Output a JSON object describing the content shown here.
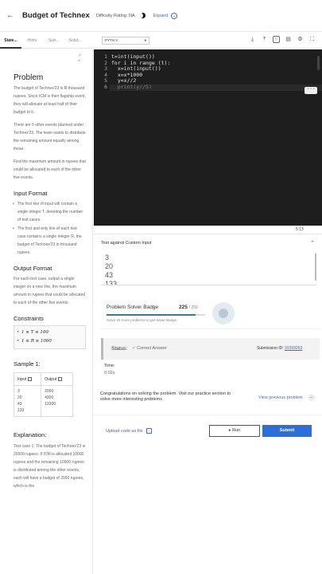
{
  "header": {
    "title": "Budget of Technex",
    "difficulty": "Difficulty Rating: NA",
    "expand_label": "Expand"
  },
  "tabs": [
    {
      "label": "State..."
    },
    {
      "label": "Hints"
    },
    {
      "label": "Sub..."
    },
    {
      "label": "Solut..."
    }
  ],
  "editor": {
    "language": "PYTH 3",
    "line_numbers": [
      "1",
      "2",
      "3",
      "4",
      "5",
      "6"
    ],
    "code_lines": [
      "t=int(input())",
      "for i in range (t):",
      "  x=int(input())",
      "  x=x*1000",
      "  y=x//2",
      "  print(y//5)"
    ],
    "cursor_position": "5:13"
  },
  "problem": {
    "heading": "Problem",
    "statement_1": "The budget of Technex'23 is R thousand rupees. Since ICM is their flagship event, they will allocate at least half of their budget to it.",
    "statement_2": "There are 5 other events planned under Technex'23. The team wants to distribute the remaining amount equally among these.",
    "statement_3": "Find the maximum amount in rupees that could be allocated to each of the other five events.",
    "input_heading": "Input Format",
    "input_items": [
      "The first line of input will contain a single integer T, denoting the number of test cases.",
      "The first and only line of each test case contains a single integer R, the budget of Technex'23 in thousand rupees."
    ],
    "output_heading": "Output Format",
    "output_text": "For each test case, output a single integer on a new line, the maximum amount in rupees that could be allocated to each of the other five events.",
    "constraints_heading": "Constraints",
    "constraints": [
      "1 ≤ T ≤ 100",
      "1 ≤ R ≤ 1000"
    ],
    "sample_heading": "Sample 1:",
    "sample_input_header": "Input",
    "sample_output_header": "Output",
    "sample_input": [
      "3",
      "20",
      "43",
      "133"
    ],
    "sample_output": [
      "2000",
      "4300",
      "13300"
    ],
    "explanation_heading": "Explanation:",
    "explanation_text": "Test case 1: The budget of Technex'23 is 20000 rupees. If ICM is allocated 10000 rupees and the remaining 10000 rupees is distributed among the other events, each will have a budget of 2000 rupees, which is the"
  },
  "custom_input": {
    "label": "Test against Custom Input",
    "lines": [
      "3",
      "20",
      "43",
      "133"
    ]
  },
  "badge": {
    "title": "Problem Solver Badge",
    "current": "225",
    "total": "/ 250",
    "progress_fraction": 0.9,
    "subtitle": "Solve 25 more problems to get Silver Badge"
  },
  "result": {
    "status_label": "Status:",
    "status_value": "Correct Answer",
    "submission_label": "Submission ID:",
    "submission_id": "93393053",
    "time_label": "Time:",
    "time_value": "0.02s"
  },
  "congrats_text": "Congratulations on solving the problem. Visit our practice section to solve more interesting problems",
  "view_previous": "View previous problem",
  "actions": {
    "upload": "Upload code as file",
    "run": "Run",
    "submit": "Submit"
  },
  "colors": {
    "accent": "#2d6fd8",
    "editor_bg": "#1e1e1e",
    "success": "#2e9a57"
  }
}
